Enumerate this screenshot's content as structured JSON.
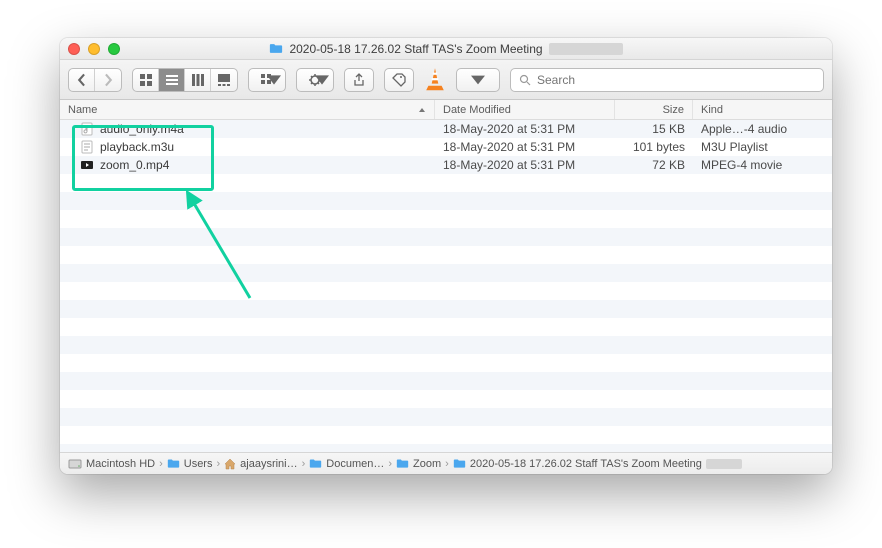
{
  "window": {
    "title": "2020-05-18 17.26.02 Staff TAS's Zoom Meeting"
  },
  "toolbar": {
    "search_placeholder": "Search"
  },
  "columns": {
    "name": "Name",
    "date": "Date Modified",
    "size": "Size",
    "kind": "Kind"
  },
  "files": [
    {
      "icon": "audio",
      "name": "audio_only.m4a",
      "date": "18-May-2020 at 5:31 PM",
      "size": "15 KB",
      "kind": "Apple…-4 audio"
    },
    {
      "icon": "playlist",
      "name": "playback.m3u",
      "date": "18-May-2020 at 5:31 PM",
      "size": "101 bytes",
      "kind": "M3U Playlist"
    },
    {
      "icon": "video",
      "name": "zoom_0.mp4",
      "date": "18-May-2020 at 5:31 PM",
      "size": "72 KB",
      "kind": "MPEG-4 movie"
    }
  ],
  "path": [
    {
      "icon": "disk",
      "label": "Macintosh HD"
    },
    {
      "icon": "folder",
      "label": "Users"
    },
    {
      "icon": "home",
      "label": "ajaaysrini…"
    },
    {
      "icon": "folder",
      "label": "Documen…"
    },
    {
      "icon": "folder",
      "label": "Zoom"
    },
    {
      "icon": "folder",
      "label": "2020-05-18 17.26.02 Staff TAS's Zoom Meeting"
    }
  ]
}
